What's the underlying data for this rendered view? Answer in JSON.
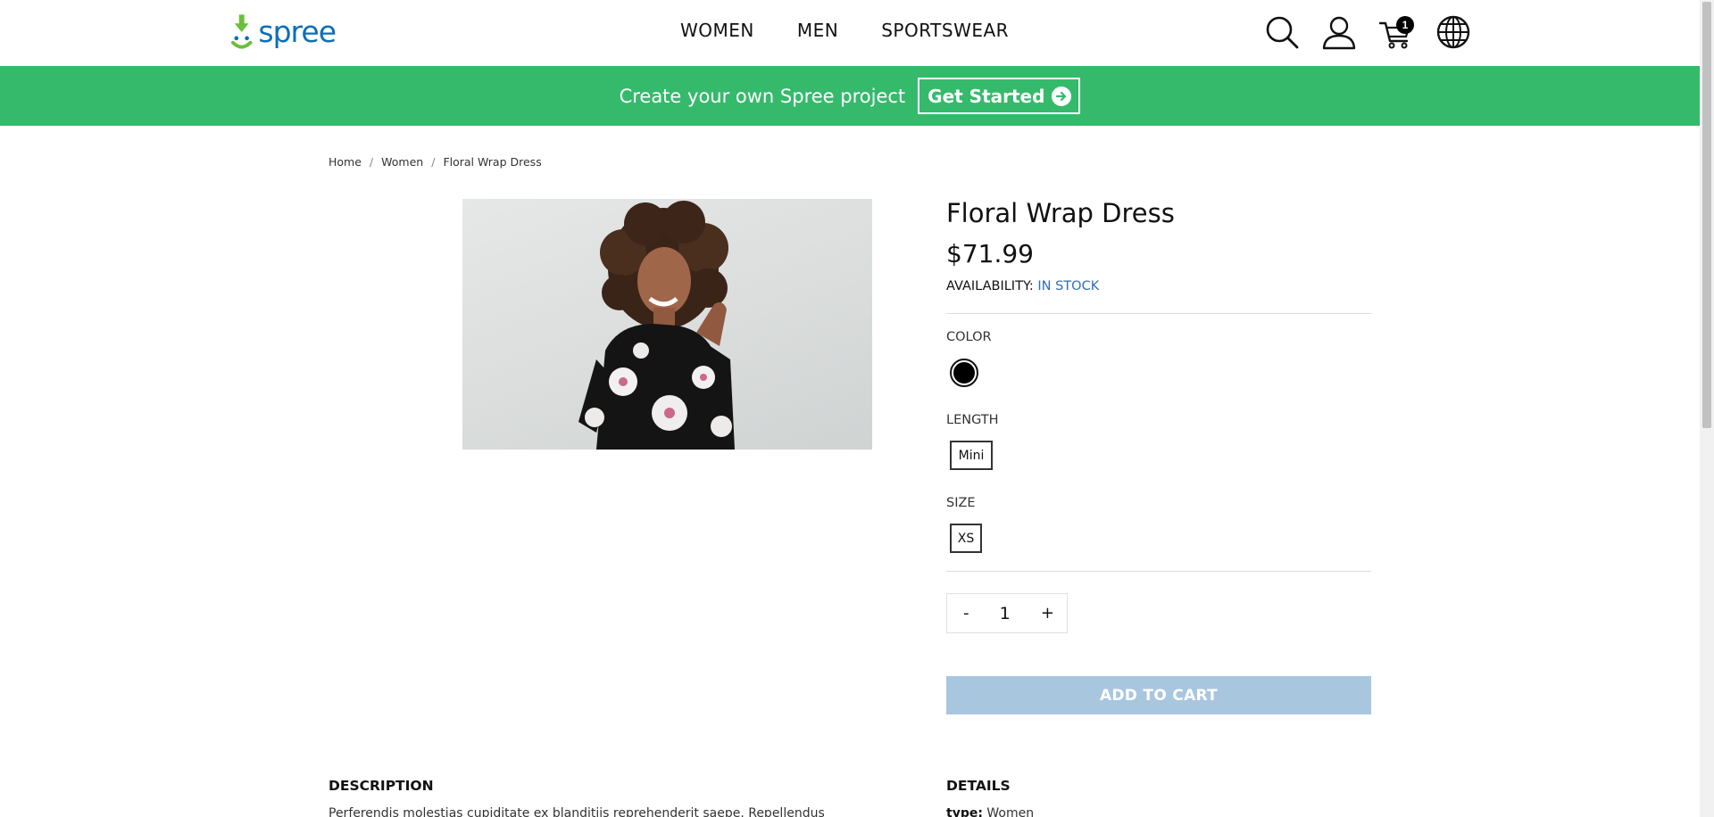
{
  "header": {
    "logo_text": "spree",
    "nav": [
      {
        "label": "WOMEN"
      },
      {
        "label": "MEN"
      },
      {
        "label": "SPORTSWEAR"
      }
    ],
    "cart_count": "1",
    "icons": [
      "search-icon",
      "account-icon",
      "cart-icon",
      "globe-icon"
    ]
  },
  "banner": {
    "text": "Create your own Spree project",
    "button_label": "Get Started",
    "color": "#35ba6c"
  },
  "breadcrumb": [
    {
      "label": "Home"
    },
    {
      "label": "Women"
    },
    {
      "label": "Floral Wrap Dress"
    }
  ],
  "product": {
    "title": "Floral Wrap Dress",
    "price": "$71.99",
    "availability_label": "AVAILABILITY:",
    "availability_value": "IN STOCK",
    "options": {
      "color_label": "COLOR",
      "color_selected": "#000000",
      "length_label": "LENGTH",
      "length_value": "Mini",
      "size_label": "SIZE",
      "size_value": "XS"
    },
    "quantity": {
      "minus": "-",
      "value": "1",
      "plus": "+"
    },
    "add_to_cart_label": "ADD TO CART"
  },
  "sections": {
    "description_heading": "DESCRIPTION",
    "description_text": "Perferendis molestias cupiditate ex blanditiis reprehenderit saepe. Repellendus",
    "details_heading": "DETAILS",
    "details_key": "type:",
    "details_value": "Women"
  }
}
